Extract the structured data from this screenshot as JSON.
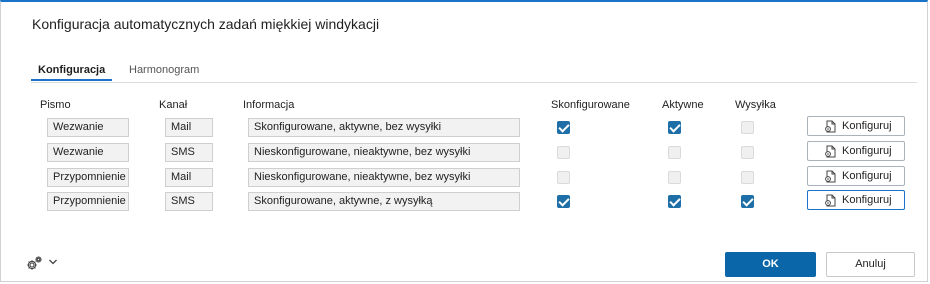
{
  "dialog": {
    "title": "Konfiguracja automatycznych zadań miękkiej windykacji",
    "tabs": [
      {
        "label": "Konfiguracja",
        "active": true
      },
      {
        "label": "Harmonogram",
        "active": false
      }
    ],
    "columns": {
      "pismo": "Pismo",
      "kanal": "Kanał",
      "informacja": "Informacja",
      "skonfigurowane": "Skonfigurowane",
      "aktywne": "Aktywne",
      "wysylka": "Wysyłka"
    },
    "rows": [
      {
        "pismo": "Wezwanie",
        "kanal": "Mail",
        "informacja": "Skonfigurowane, aktywne, bez wysyłki",
        "skonfigurowane": true,
        "aktywne": true,
        "wysylka": false,
        "button": "Konfiguruj"
      },
      {
        "pismo": "Wezwanie",
        "kanal": "SMS",
        "informacja": "Nieskonfigurowane, nieaktywne, bez wysyłki",
        "skonfigurowane": false,
        "aktywne": false,
        "wysylka": false,
        "button": "Konfiguruj"
      },
      {
        "pismo": "Przypomnienie",
        "kanal": "Mail",
        "informacja": "Nieskonfigurowane, nieaktywne, bez wysyłki",
        "skonfigurowane": false,
        "aktywne": false,
        "wysylka": false,
        "button": "Konfiguruj"
      },
      {
        "pismo": "Przypomnienie",
        "kanal": "SMS",
        "informacja": "Skonfigurowane, aktywne, z wysyłką",
        "skonfigurowane": true,
        "aktywne": true,
        "wysylka": true,
        "button": "Konfiguruj"
      }
    ],
    "footer": {
      "settings_icon": "gear-icon",
      "ok_label": "OK",
      "cancel_label": "Anuluj"
    },
    "colors": {
      "accent": "#1a73c8",
      "primary_button": "#0a66a8",
      "checkbox_checked": "#1e6fa8"
    }
  }
}
